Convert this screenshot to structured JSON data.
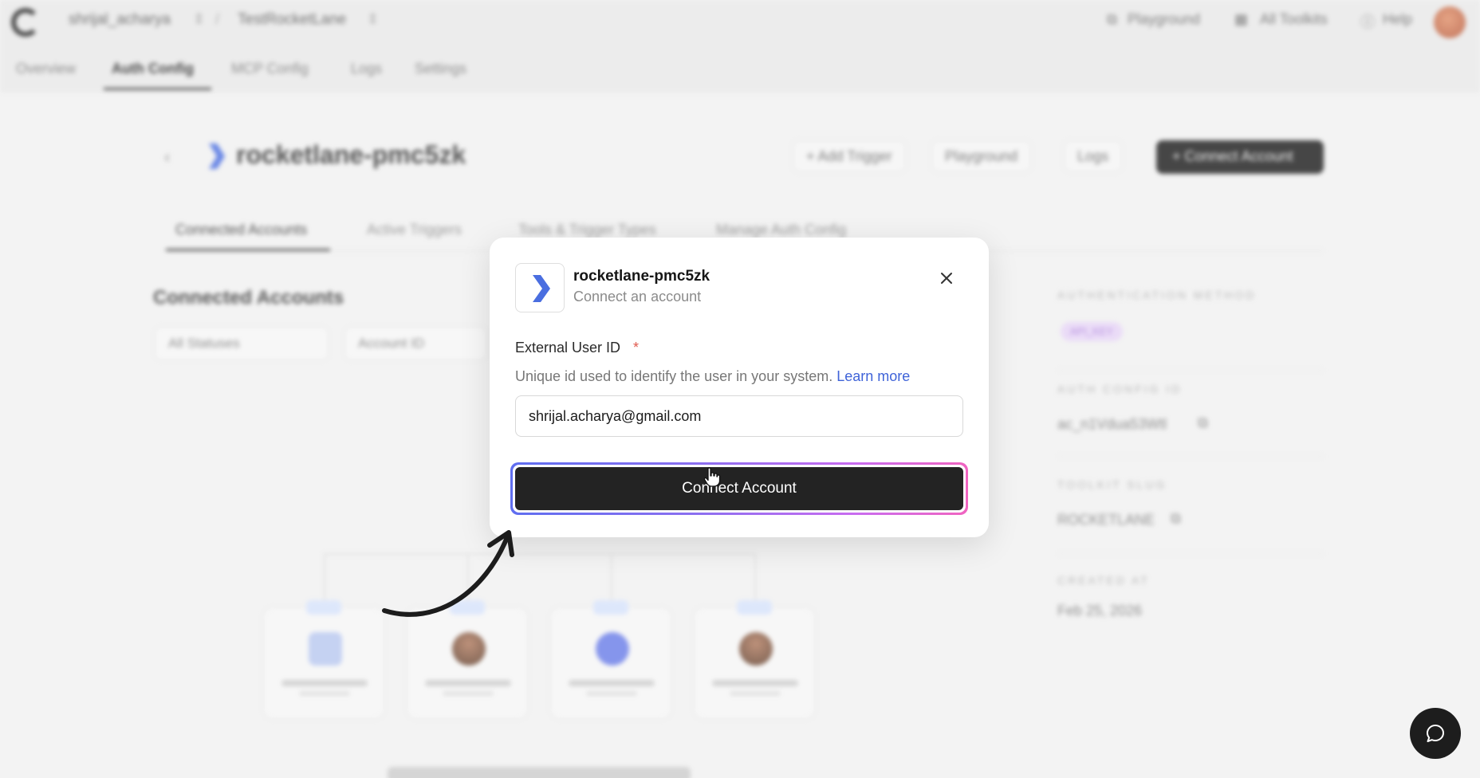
{
  "topbar": {
    "workspace": "shrijal_acharya",
    "project": "TestRocketLane",
    "playground": "Playground",
    "all_toolkits": "All Toolkits",
    "help": "Help"
  },
  "nav_tabs": [
    "Overview",
    "Auth Config",
    "MCP Config",
    "Logs",
    "Settings"
  ],
  "page": {
    "title": "rocketlane-pmc5zk",
    "add_trigger": "+ Add Trigger",
    "playground": "Playground",
    "logs": "Logs",
    "connect_account": "+ Connect Account",
    "sub_tabs": [
      "Connected Accounts",
      "Active Triggers",
      "Tools & Trigger Types",
      "Manage Auth Config"
    ],
    "section_title": "Connected Accounts",
    "filter_status": "All Statuses",
    "filter_account": "Account ID"
  },
  "sidebar": {
    "auth_method_label": "AUTHENTICATION METHOD",
    "auth_method_value": "API_KEY",
    "auth_config_label": "AUTH CONFIG ID",
    "auth_config_value": "ac_n1Vdua53Wtl",
    "toolkit_label": "TOOLKIT SLUG",
    "toolkit_value": "ROCKETLANE",
    "created_label": "CREATED AT",
    "created_value": "Feb 25, 2026"
  },
  "modal": {
    "title": "rocketlane-pmc5zk",
    "subtitle": "Connect an account",
    "field_label": "External User ID",
    "required_mark": "*",
    "help_text": "Unique id used to identify the user in your system.",
    "help_link": "Learn more",
    "input_value": "shrijal.acharya@gmail.com",
    "submit_label": "Connect Account"
  },
  "colors": {
    "accent_blue": "#3f63d8",
    "brand_logo": "#4a6ee0",
    "required_red": "#e05a4e",
    "button_dark": "#232323"
  },
  "icons": {
    "close": "close-icon",
    "chat": "chat-bubble-icon",
    "cursor": "hand-cursor-icon"
  }
}
